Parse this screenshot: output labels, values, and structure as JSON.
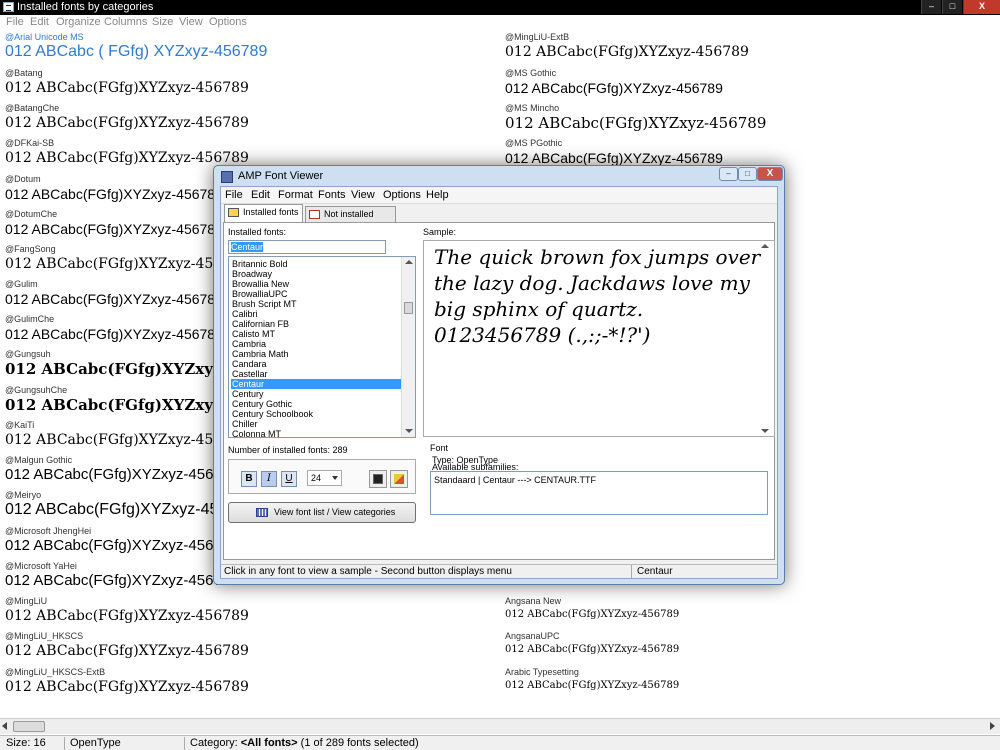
{
  "window": {
    "title": "Installed fonts by categories",
    "buttons": {
      "minimize": "–",
      "maximize": "□",
      "close": "X"
    }
  },
  "menu": [
    "File",
    "Edit",
    "Organize",
    "Columns",
    "Size",
    "View",
    "Options"
  ],
  "left_fonts": [
    {
      "name": "@Arial Unicode MS",
      "sample": "012 ABCabc ( FGfg)  XYZxyz-456789",
      "highlight": true
    },
    {
      "name": "@Batang",
      "sample": "012 ABCabc(FGfg)XYZxyz-456789"
    },
    {
      "name": "@BatangChe",
      "sample": "012 ABCabc(FGfg)XYZxyz-456789"
    },
    {
      "name": "@DFKai-SB",
      "sample": "012 ABCabc(FGfg)XYZxyz-456789"
    },
    {
      "name": "@Dotum",
      "sample": "012 ABCabc(FGfg)XYZxyz-456789"
    },
    {
      "name": "@DotumChe",
      "sample": "012 ABCabc(FGfg)XYZxyz-456789"
    },
    {
      "name": "@FangSong",
      "sample": "012 ABCabc(FGfg)XYZxyz-456789"
    },
    {
      "name": "@Gulim",
      "sample": "012 ABCabc(FGfg)XYZxyz-456789"
    },
    {
      "name": "@GulimChe",
      "sample": "012 ABCabc(FGfg)XYZxyz-456789"
    },
    {
      "name": "@Gungsuh",
      "sample": "012 ABCabc(FGfg)XYZxyz-456789"
    },
    {
      "name": "@GungsuhChe",
      "sample": "012 ABCabc(FGfg)XYZxyz-456789"
    },
    {
      "name": "@KaiTi",
      "sample": "012 ABCabc(FGfg)XYZxyz-456789"
    },
    {
      "name": "@Malgun Gothic",
      "sample": "012 ABCabc(FGfg)XYZxyz-456789"
    },
    {
      "name": "@Meiryo",
      "sample": "012 ABCabc(FGfg)XYZxyz-456789"
    },
    {
      "name": "@Microsoft JhengHei",
      "sample": "012 ABCabc(FGfg)XYZxyz-456789"
    },
    {
      "name": "@Microsoft YaHei",
      "sample": "012 ABCabc(FGfg)XYZxyz-456789"
    },
    {
      "name": "@MingLiU",
      "sample": "012 ABCabc(FGfg)XYZxyz-456789"
    },
    {
      "name": "@MingLiU_HKSCS",
      "sample": "012 ABCabc(FGfg)XYZxyz-456789"
    },
    {
      "name": "@MingLiU_HKSCS-ExtB",
      "sample": "012 ABCabc(FGfg)XYZxyz-456789"
    }
  ],
  "right_fonts": [
    {
      "name": "@MingLiU-ExtB",
      "sample": "012 ABCabc(FGfg)XYZxyz-456789"
    },
    {
      "name": "@MS Gothic",
      "sample": "012 ABCabc(FGfg)XYZxyz-456789"
    },
    {
      "name": "@MS Mincho",
      "sample": "012 ABCabc(FGfg)XYZxyz-456789"
    },
    {
      "name": "@MS PGothic",
      "sample": "012 ABCabc(FGfg)XYZxyz-456789"
    },
    {
      "name": "Angsana New",
      "sample": "012 ABCabc(FGfg)XYZxyz-456789"
    },
    {
      "name": "AngsanaUPC",
      "sample": "012 ABCabc(FGfg)XYZxyz-456789"
    },
    {
      "name": "Arabic Typesetting",
      "sample": "012 ABCabc(FGfg)XYZxyz-456789"
    }
  ],
  "status": {
    "size": "Size: 16",
    "type": "OpenType",
    "category_prefix": "Category: ",
    "category_value": "<All fonts>",
    "category_suffix": " (1 of 289 fonts selected)"
  },
  "dialog": {
    "title": "AMP Font Viewer",
    "buttons": {
      "minimize": "–",
      "maximize": "□",
      "close": "X"
    },
    "menu": [
      "File",
      "Edit",
      "Format",
      "Fonts",
      "View",
      "Options",
      "Help"
    ],
    "tabs": [
      "Installed fonts",
      "Not installed fonts"
    ],
    "installed_label": "Installed fonts:",
    "search_value": "Centaur",
    "font_list": [
      "Britannic Bold",
      "Broadway",
      "Browallia New",
      "BrowalliaUPC",
      "Brush Script MT",
      "Calibri",
      "Californian FB",
      "Calisto MT",
      "Cambria",
      "Cambria Math",
      "Candara",
      "Castellar",
      "Centaur",
      "Century",
      "Century Gothic",
      "Century Schoolbook",
      "Chiller",
      "Colonna MT"
    ],
    "selected_font": "Centaur",
    "count_label": "Number of installed fonts:  289",
    "format": {
      "bold": "B",
      "italic": "I",
      "underline": "U",
      "size": "24"
    },
    "view_button": "View font list / View categories",
    "sample_label": "Sample:",
    "sample_text": "The quick brown fox jumps over the lazy dog. Jackdaws love my big sphinx of quartz. 0123456789 (.,:;-*!?')",
    "font_group_label": "Font",
    "type_line": "Type:  OpenType",
    "subfam_label": "Available subfamilies:",
    "subfam_value": "Standaard  |  Centaur  --->  CENTAUR.TTF",
    "status_left": "Click in any font to view a sample - Second button displays menu",
    "status_right": "Centaur"
  },
  "colors": {
    "accent_blue": "#3399ff",
    "highlight_text": "#2e7bd1",
    "dialog_frame": "#cddff0"
  }
}
